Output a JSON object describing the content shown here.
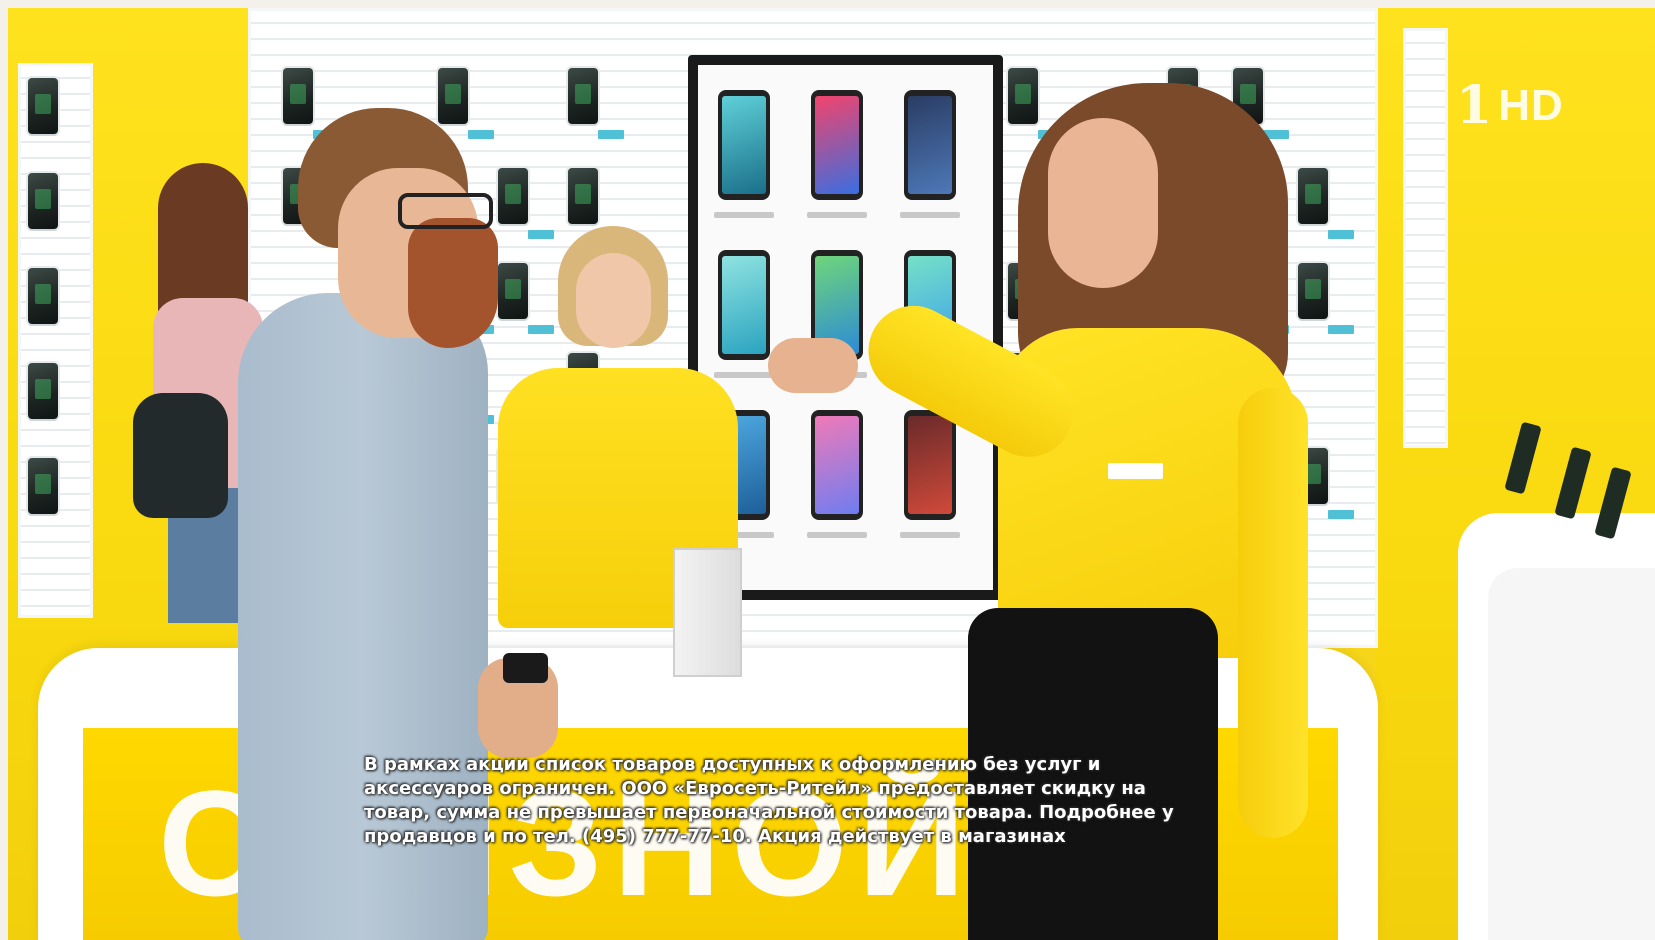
{
  "counter": {
    "brand_text": "СВЯЗНОЙ"
  },
  "overlay": {
    "channel_hd": "HD",
    "channel_mark": "1",
    "disclaimer_lines": [
      "В рамках акции список товаров доступных к оформлению без услуг и",
      "аксессуаров ограничен.  ООО «Евросеть-Ритейл» предоставляет скидку на",
      "товар, сумма не превышает первоначальной стоимости товара. Подробнее у",
      "продавцов и по тел. (495) 777-77-10. Акция действует в магазинах"
    ]
  },
  "colors": {
    "brand_yellow": "#ffd800",
    "uniform_yellow": "#ffe022",
    "wall_white": "#ffffff"
  }
}
